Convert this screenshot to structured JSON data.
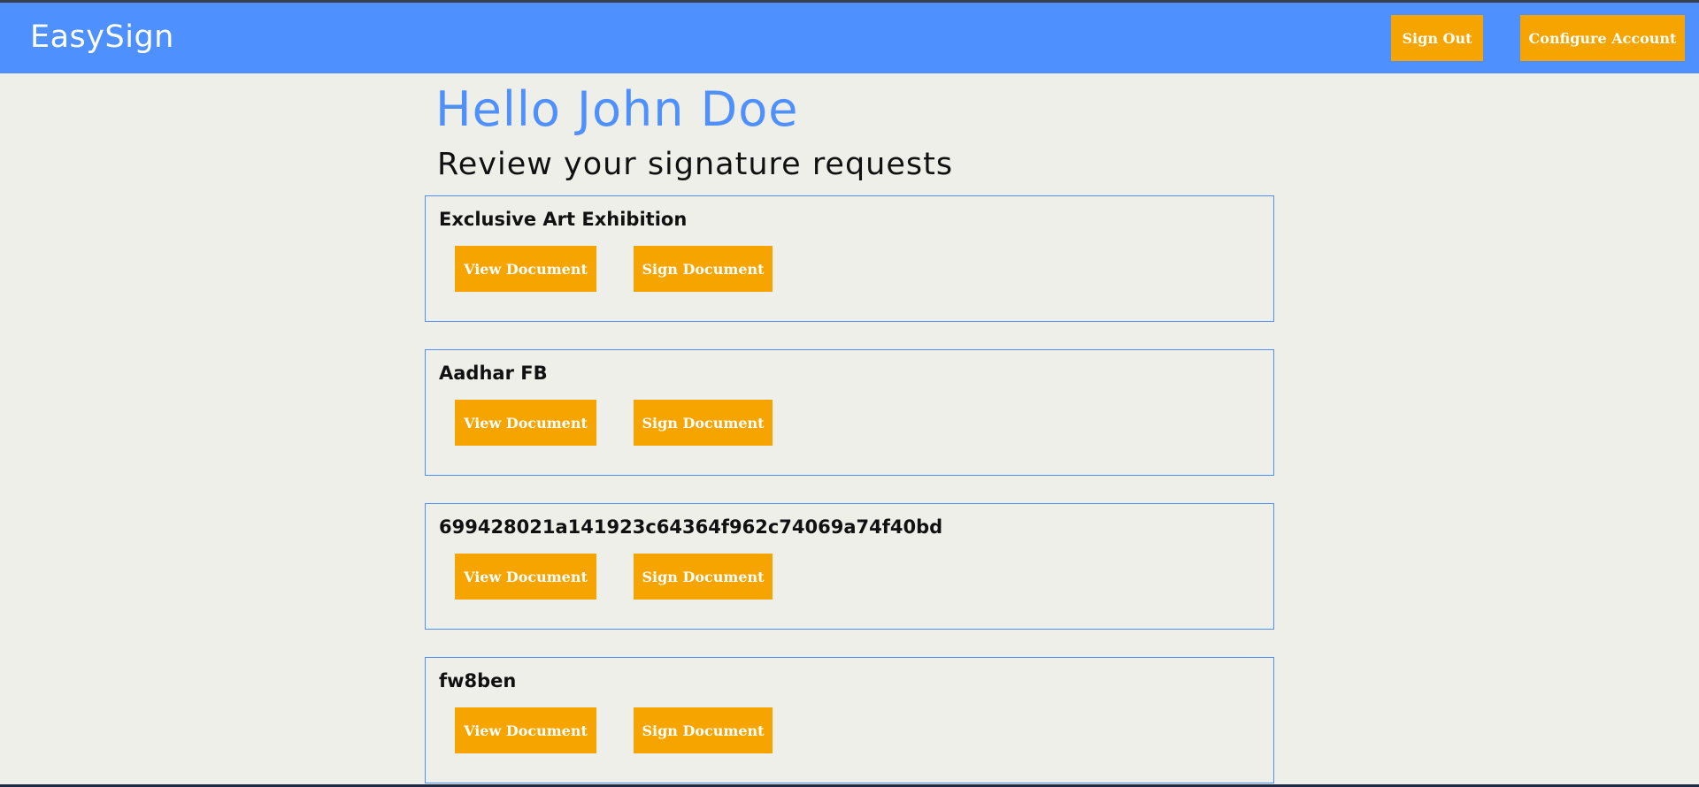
{
  "app": {
    "brand": "EasySign"
  },
  "nav": {
    "sign_out_label": "Sign Out",
    "configure_label": "Configure Account"
  },
  "main": {
    "greeting": "Hello John Doe",
    "subheading": "Review your signature requests"
  },
  "requests": [
    {
      "title": "Exclusive Art Exhibition",
      "view_label": "View Document",
      "sign_label": "Sign Document"
    },
    {
      "title": "Aadhar FB",
      "view_label": "View Document",
      "sign_label": "Sign Document"
    },
    {
      "title": "699428021a141923c64364f962c74069a74f40bd",
      "view_label": "View Document",
      "sign_label": "Sign Document"
    },
    {
      "title": "fw8ben",
      "view_label": "View Document",
      "sign_label": "Sign Document"
    }
  ],
  "colors": {
    "navbar": "#4f90ff",
    "accent_button": "#f6a400",
    "background": "#efefea",
    "greeting": "#4f90ff",
    "card_border": "#4f90ff"
  }
}
